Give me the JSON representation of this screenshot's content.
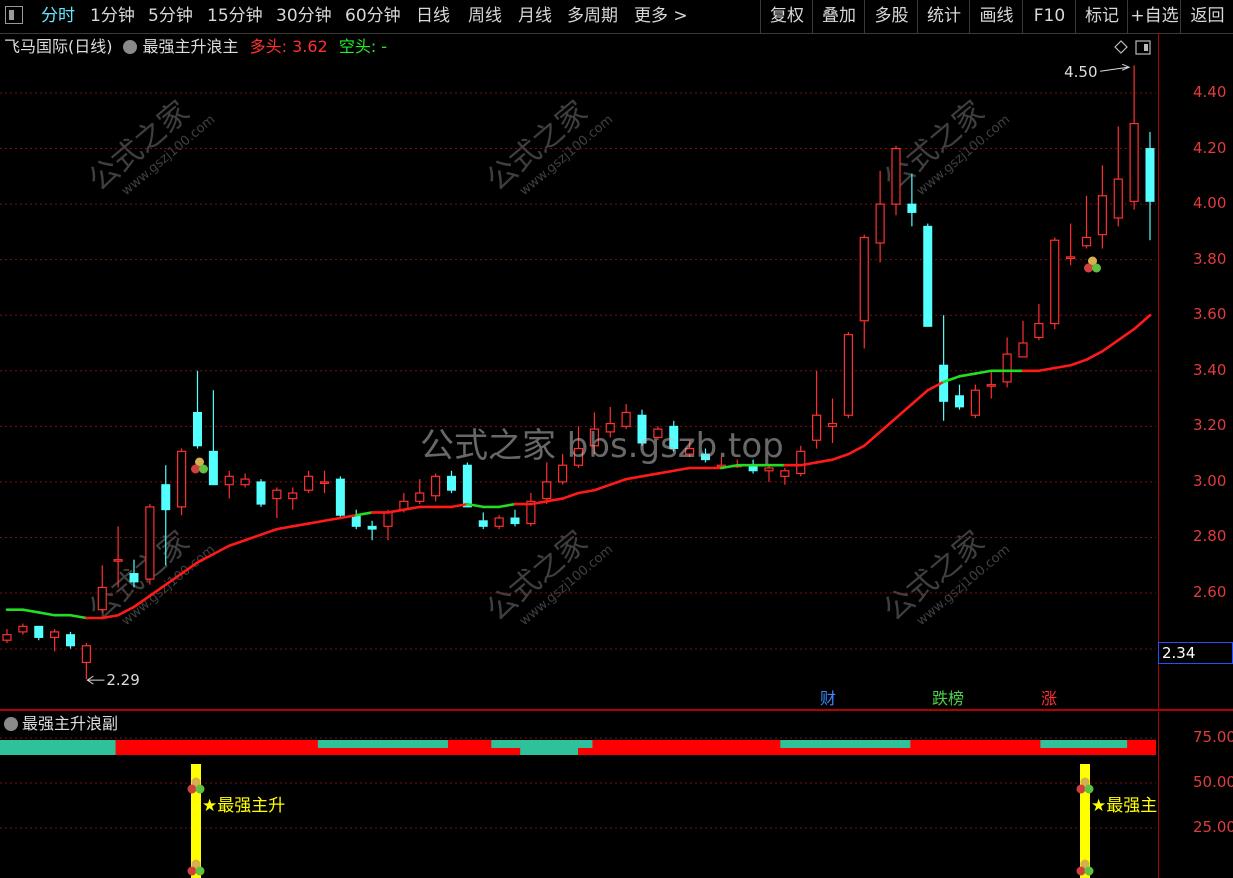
{
  "toolbar": {
    "periods": [
      "分时",
      "1分钟",
      "5分钟",
      "15分钟",
      "30分钟",
      "60分钟",
      "日线",
      "周线",
      "月线",
      "多周期",
      "更多 >"
    ],
    "active_period": "分时",
    "actions": [
      "复权",
      "叠加",
      "多股",
      "统计",
      "画线",
      "F10",
      "标记",
      "+自选",
      "返回"
    ]
  },
  "main_chart": {
    "stock_title": "飞马国际(日线)",
    "indicator_name": "最强主升浪主",
    "bull_label": "多头: 3.62",
    "bear_label": "空头: -",
    "high_annotation": "4.50",
    "low_annotation": "2.29",
    "last_price": "2.34",
    "event_tags": [
      "财",
      "跌榜",
      "涨"
    ]
  },
  "sub_chart": {
    "indicator_name": "最强主升浪副",
    "signal_text_1": "★最强主升",
    "signal_text_2": "★最强主"
  },
  "watermark": {
    "center": "公式之家 bbs.gszb.top",
    "brand": "公式之家",
    "site": "www.gszj100.com"
  },
  "colors": {
    "up": "#ff3030",
    "down": "#54ffff",
    "ma_up": "#ff1a1a",
    "ma_down": "#22dd22",
    "signal": "#ffff00",
    "band_green": "#2fc19a",
    "band_red": "#ff0000"
  },
  "chart_data": {
    "type": "candlestick",
    "title": "飞马国际(日线)",
    "price_ticks": [
      "4.40",
      "4.20",
      "4.00",
      "3.80",
      "3.60",
      "3.40",
      "3.20",
      "3.00",
      "2.80",
      "2.60"
    ],
    "ylim": [
      2.2,
      4.6
    ],
    "sub_ticks": [
      "75.00",
      "50.00",
      "25.00"
    ],
    "sub_ylim": [
      0,
      100
    ],
    "candles": [
      {
        "o": 2.43,
        "c": 2.45,
        "h": 2.47,
        "l": 2.42
      },
      {
        "o": 2.46,
        "c": 2.48,
        "h": 2.49,
        "l": 2.45
      },
      {
        "o": 2.48,
        "c": 2.44,
        "h": 2.48,
        "l": 2.43
      },
      {
        "o": 2.44,
        "c": 2.46,
        "h": 2.47,
        "l": 2.39
      },
      {
        "o": 2.45,
        "c": 2.41,
        "h": 2.46,
        "l": 2.4
      },
      {
        "o": 2.35,
        "c": 2.41,
        "h": 2.42,
        "l": 2.29
      },
      {
        "o": 2.54,
        "c": 2.62,
        "h": 2.7,
        "l": 2.53
      },
      {
        "o": 2.72,
        "c": 2.72,
        "h": 2.84,
        "l": 2.62
      },
      {
        "o": 2.67,
        "c": 2.64,
        "h": 2.72,
        "l": 2.62
      },
      {
        "o": 2.65,
        "c": 2.91,
        "h": 2.92,
        "l": 2.63
      },
      {
        "o": 2.99,
        "c": 2.9,
        "h": 3.06,
        "l": 2.7
      },
      {
        "o": 2.91,
        "c": 3.11,
        "h": 3.12,
        "l": 2.88
      },
      {
        "o": 3.25,
        "c": 3.13,
        "h": 3.4,
        "l": 3.12
      },
      {
        "o": 3.11,
        "c": 2.99,
        "h": 3.33,
        "l": 2.99
      },
      {
        "o": 2.99,
        "c": 3.02,
        "h": 3.04,
        "l": 2.94
      },
      {
        "o": 2.99,
        "c": 3.01,
        "h": 3.03,
        "l": 2.98
      },
      {
        "o": 3.0,
        "c": 2.92,
        "h": 3.01,
        "l": 2.91
      },
      {
        "o": 2.94,
        "c": 2.97,
        "h": 2.98,
        "l": 2.87
      },
      {
        "o": 2.94,
        "c": 2.96,
        "h": 2.98,
        "l": 2.9
      },
      {
        "o": 2.97,
        "c": 3.02,
        "h": 3.04,
        "l": 2.96
      },
      {
        "o": 3.0,
        "c": 3.0,
        "h": 3.04,
        "l": 2.96
      },
      {
        "o": 3.01,
        "c": 2.88,
        "h": 3.02,
        "l": 2.87
      },
      {
        "o": 2.88,
        "c": 2.84,
        "h": 2.9,
        "l": 2.83
      },
      {
        "o": 2.84,
        "c": 2.83,
        "h": 2.86,
        "l": 2.79
      },
      {
        "o": 2.84,
        "c": 2.89,
        "h": 2.9,
        "l": 2.79
      },
      {
        "o": 2.9,
        "c": 2.93,
        "h": 2.96,
        "l": 2.89
      },
      {
        "o": 2.93,
        "c": 2.96,
        "h": 3.01,
        "l": 2.92
      },
      {
        "o": 2.95,
        "c": 3.02,
        "h": 3.03,
        "l": 2.93
      },
      {
        "o": 3.02,
        "c": 2.97,
        "h": 3.04,
        "l": 2.96
      },
      {
        "o": 3.06,
        "c": 2.91,
        "h": 3.07,
        "l": 2.91
      },
      {
        "o": 2.86,
        "c": 2.84,
        "h": 2.89,
        "l": 2.83
      },
      {
        "o": 2.84,
        "c": 2.87,
        "h": 2.88,
        "l": 2.83
      },
      {
        "o": 2.87,
        "c": 2.85,
        "h": 2.9,
        "l": 2.84
      },
      {
        "o": 2.85,
        "c": 2.93,
        "h": 2.96,
        "l": 2.84
      },
      {
        "o": 2.94,
        "c": 3.0,
        "h": 3.07,
        "l": 2.92
      },
      {
        "o": 3.0,
        "c": 3.06,
        "h": 3.1,
        "l": 2.99
      },
      {
        "o": 3.06,
        "c": 3.12,
        "h": 3.2,
        "l": 3.05
      },
      {
        "o": 3.13,
        "c": 3.19,
        "h": 3.25,
        "l": 3.1
      },
      {
        "o": 3.18,
        "c": 3.21,
        "h": 3.27,
        "l": 3.16
      },
      {
        "o": 3.2,
        "c": 3.25,
        "h": 3.28,
        "l": 3.19
      },
      {
        "o": 3.24,
        "c": 3.14,
        "h": 3.26,
        "l": 3.13
      },
      {
        "o": 3.16,
        "c": 3.19,
        "h": 3.2,
        "l": 3.15
      },
      {
        "o": 3.2,
        "c": 3.12,
        "h": 3.22,
        "l": 3.11
      },
      {
        "o": 3.1,
        "c": 3.12,
        "h": 3.15,
        "l": 3.09
      },
      {
        "o": 3.1,
        "c": 3.08,
        "h": 3.12,
        "l": 3.07
      },
      {
        "o": 3.06,
        "c": 3.06,
        "h": 3.09,
        "l": 3.05
      },
      {
        "o": 3.06,
        "c": 3.06,
        "h": 3.08,
        "l": 3.05
      },
      {
        "o": 3.06,
        "c": 3.04,
        "h": 3.08,
        "l": 3.03
      },
      {
        "o": 3.04,
        "c": 3.05,
        "h": 3.06,
        "l": 3.0
      },
      {
        "o": 3.02,
        "c": 3.04,
        "h": 3.05,
        "l": 2.99
      },
      {
        "o": 3.03,
        "c": 3.11,
        "h": 3.13,
        "l": 3.02
      },
      {
        "o": 3.15,
        "c": 3.24,
        "h": 3.4,
        "l": 3.12
      },
      {
        "o": 3.2,
        "c": 3.21,
        "h": 3.3,
        "l": 3.14
      },
      {
        "o": 3.24,
        "c": 3.53,
        "h": 3.54,
        "l": 3.23
      },
      {
        "o": 3.58,
        "c": 3.88,
        "h": 3.89,
        "l": 3.48
      },
      {
        "o": 3.86,
        "c": 4.0,
        "h": 4.12,
        "l": 3.79
      },
      {
        "o": 4.0,
        "c": 4.2,
        "h": 4.21,
        "l": 3.96
      },
      {
        "o": 4.0,
        "c": 3.97,
        "h": 4.11,
        "l": 3.92
      },
      {
        "o": 3.92,
        "c": 3.56,
        "h": 3.93,
        "l": 3.56
      },
      {
        "o": 3.42,
        "c": 3.29,
        "h": 3.6,
        "l": 3.22
      },
      {
        "o": 3.31,
        "c": 3.27,
        "h": 3.35,
        "l": 3.26
      },
      {
        "o": 3.24,
        "c": 3.33,
        "h": 3.35,
        "l": 3.23
      },
      {
        "o": 3.35,
        "c": 3.35,
        "h": 3.4,
        "l": 3.3
      },
      {
        "o": 3.36,
        "c": 3.46,
        "h": 3.52,
        "l": 3.34
      },
      {
        "o": 3.45,
        "c": 3.5,
        "h": 3.58,
        "l": 3.45
      },
      {
        "o": 3.52,
        "c": 3.57,
        "h": 3.64,
        "l": 3.51
      },
      {
        "o": 3.57,
        "c": 3.87,
        "h": 3.88,
        "l": 3.55
      },
      {
        "o": 3.81,
        "c": 3.81,
        "h": 3.93,
        "l": 3.78
      },
      {
        "o": 3.85,
        "c": 3.88,
        "h": 4.03,
        "l": 3.84
      },
      {
        "o": 3.89,
        "c": 4.03,
        "h": 4.14,
        "l": 3.84
      },
      {
        "o": 3.95,
        "c": 4.09,
        "h": 4.28,
        "l": 3.92
      },
      {
        "o": 4.01,
        "c": 4.29,
        "h": 4.5,
        "l": 3.98
      },
      {
        "o": 4.2,
        "c": 4.01,
        "h": 4.26,
        "l": 3.87
      }
    ],
    "ma_values": [
      2.54,
      2.54,
      2.53,
      2.52,
      2.52,
      2.51,
      2.51,
      2.52,
      2.55,
      2.59,
      2.63,
      2.67,
      2.71,
      2.74,
      2.77,
      2.79,
      2.81,
      2.83,
      2.84,
      2.85,
      2.86,
      2.87,
      2.88,
      2.89,
      2.89,
      2.9,
      2.91,
      2.91,
      2.91,
      2.92,
      2.91,
      2.91,
      2.92,
      2.92,
      2.93,
      2.94,
      2.96,
      2.97,
      2.99,
      3.01,
      3.02,
      3.03,
      3.04,
      3.05,
      3.05,
      3.05,
      3.06,
      3.06,
      3.06,
      3.06,
      3.06,
      3.07,
      3.08,
      3.1,
      3.13,
      3.18,
      3.23,
      3.28,
      3.33,
      3.36,
      3.38,
      3.39,
      3.4,
      3.4,
      3.4,
      3.4,
      3.41,
      3.42,
      3.44,
      3.47,
      3.51,
      3.55,
      3.6
    ],
    "ma_down_ranges": [
      [
        0,
        5
      ],
      [
        22,
        23
      ],
      [
        29,
        32
      ],
      [
        45,
        49
      ],
      [
        59,
        64
      ]
    ],
    "band_green_ranges": [
      [
        0,
        8
      ],
      [
        22,
        31
      ],
      [
        34,
        41
      ],
      [
        54,
        63
      ],
      [
        72,
        78
      ]
    ],
    "band2_green_ranges": [
      [
        0,
        8
      ],
      [
        36,
        40
      ]
    ],
    "signal_days": [
      15,
      84
    ],
    "annotations": [
      {
        "text": "4.50",
        "at": "high"
      },
      {
        "text": "2.29",
        "at": "low"
      }
    ]
  }
}
